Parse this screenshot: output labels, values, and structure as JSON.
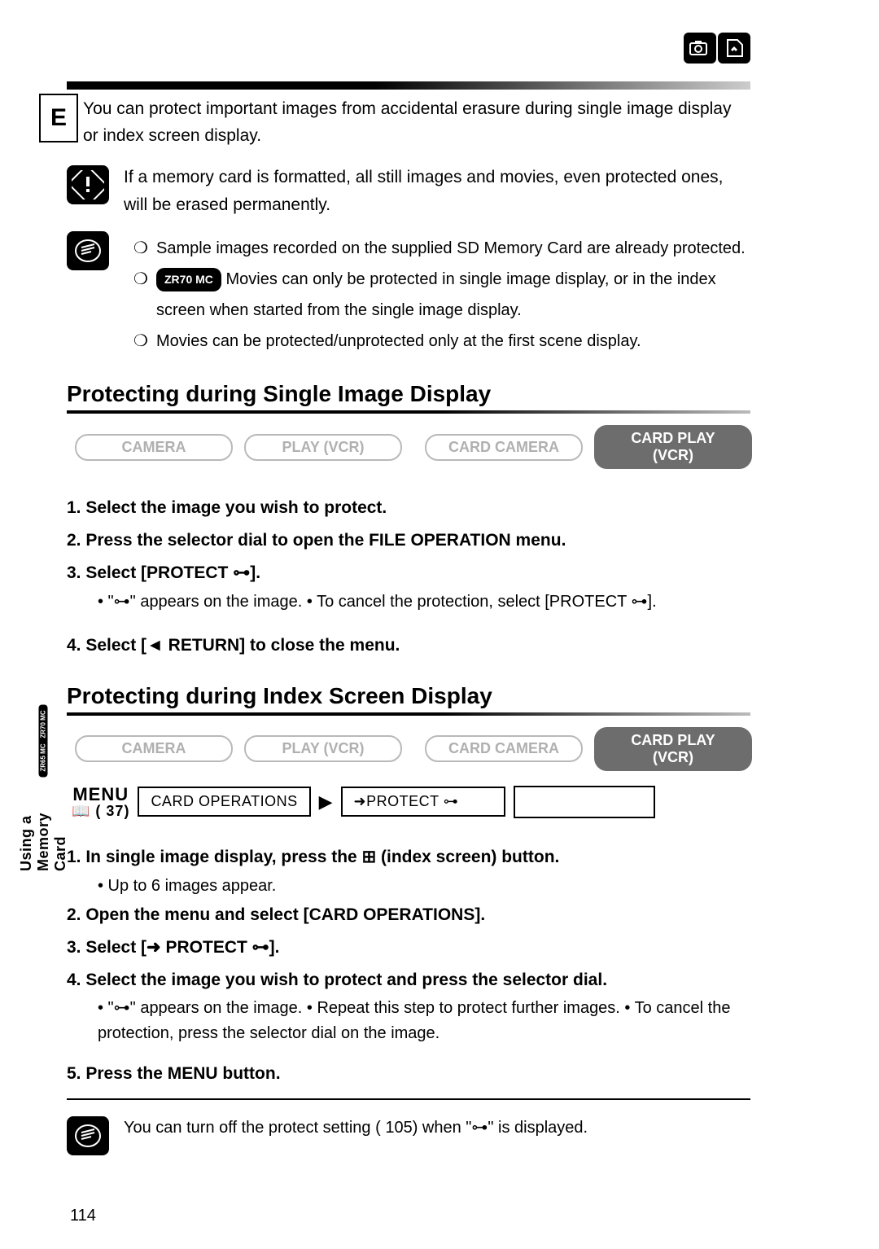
{
  "header": {
    "lang_tab": "E"
  },
  "intro": "You can protect important images from accidental erasure during single image display or index screen display.",
  "warning": "If a memory card is formatted, all still images and movies, even protected ones, will be erased permanently.",
  "notes": {
    "n1": "Sample images recorded on the supplied SD Memory Card are already protected.",
    "n2_model": "ZR70 MC",
    "n2": " Movies can only be protected in single image display, or in the index screen when started from the single image display.",
    "n3": "Movies can be protected/unprotected only at the first scene display."
  },
  "sec1": {
    "title": "Protecting during Single Image Display",
    "modes": [
      "CAMERA",
      "PLAY (VCR)",
      "CARD CAMERA",
      "CARD PLAY (VCR)"
    ],
    "step1": "1. Select the image you wish to protect.",
    "step2": "2. Press the selector dial to open the FILE OPERATION menu.",
    "step3": "3. Select [PROTECT ⊶].",
    "step3_sub": "• \"⊶\" appears on the image. • To cancel the protection, select [PROTECT ⊶].",
    "step4": "4. Select [◄ RETURN] to close the menu."
  },
  "sec2": {
    "title": "Protecting during Index Screen Display",
    "modes": [
      "CAMERA",
      "PLAY (VCR)",
      "CARD CAMERA",
      "CARD PLAY (VCR)"
    ],
    "menu_label": "MENU",
    "menu_book_ref": "( 37)",
    "path1": "CARD OPERATIONS",
    "path2": "➜PROTECT ⊶",
    "step1": "1. In single image display, press the ⊞ (index screen) button.",
    "step1_sub": "• Up to 6 images appear.",
    "step2": "2. Open the menu and select [CARD OPERATIONS].",
    "step3": "3. Select [➜ PROTECT ⊶].",
    "step4": "4. Select the image you wish to protect and press the selector dial.",
    "step4_sub": "• \"⊶\" appears on the image. • Repeat this step to protect further images. • To cancel the protection, press the selector dial on the image.",
    "step5": "5. Press the MENU button."
  },
  "side": {
    "m1": "ZR70 MC",
    "m2": "ZR65 MC",
    "text": "Using a Memory Card"
  },
  "footnote": "You can turn off the protect setting ( 105) when \"⊶\" is displayed.",
  "page_number": "114"
}
